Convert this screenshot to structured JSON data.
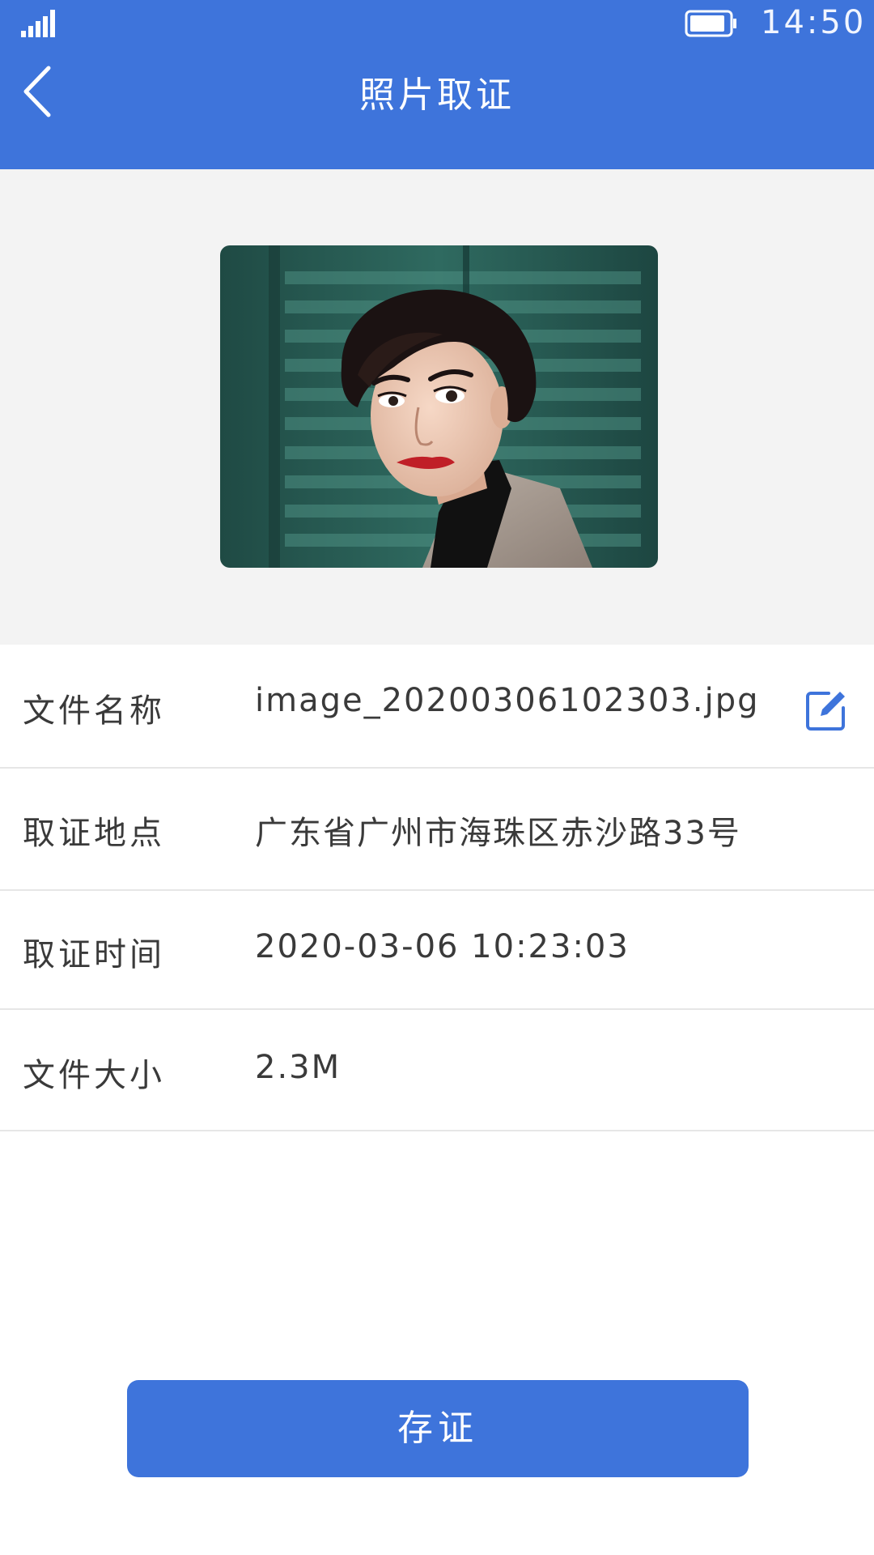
{
  "colors": {
    "primary": "#3e74db",
    "photo_background": "#f3f3f3",
    "divider": "#e6e6e6",
    "text": "#3a3a3a"
  },
  "status_bar": {
    "time": "14:50",
    "signal_icon": "signal-icon",
    "battery_icon": "battery-icon"
  },
  "header": {
    "back_icon": "chevron-left-icon",
    "title": "照片取证"
  },
  "photo": {
    "icon": "portrait-photo"
  },
  "info_rows": [
    {
      "label": "文件名称",
      "value": "image_20200306102303.jpg",
      "action_icon": "edit-icon"
    },
    {
      "label": "取证地点",
      "value": "广东省广州市海珠区赤沙路33号"
    },
    {
      "label": "取证时间",
      "value": "2020-03-06 10:23:03"
    },
    {
      "label": "文件大小",
      "value": "2.3M"
    }
  ],
  "actions": {
    "save_label": "存证"
  }
}
